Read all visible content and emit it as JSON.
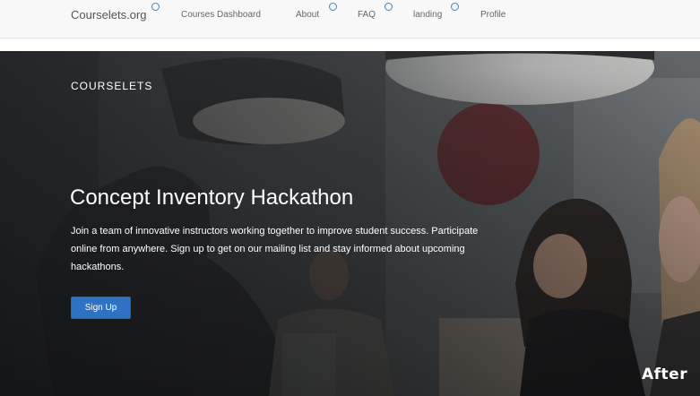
{
  "nav": {
    "brand": "Courselets.org",
    "links": [
      {
        "label": "Courses Dashboard"
      },
      {
        "label": "About"
      },
      {
        "label": "FAQ"
      },
      {
        "label": "landing"
      },
      {
        "label": "Profile"
      }
    ]
  },
  "hero": {
    "eyebrow": "COURSELETS",
    "title": "Concept Inventory Hackathon",
    "description": "Join a team of innovative instructors working together to improve student success. Participate online from anywhere. Sign up to get on our mailing list and stay informed about upcoming hackathons.",
    "signup_label": "Sign Up",
    "watermark": "After"
  },
  "colors": {
    "accent": "#2f72c3",
    "nav_dot": "#3b87c8",
    "nav_bg": "#f8f8f8"
  }
}
